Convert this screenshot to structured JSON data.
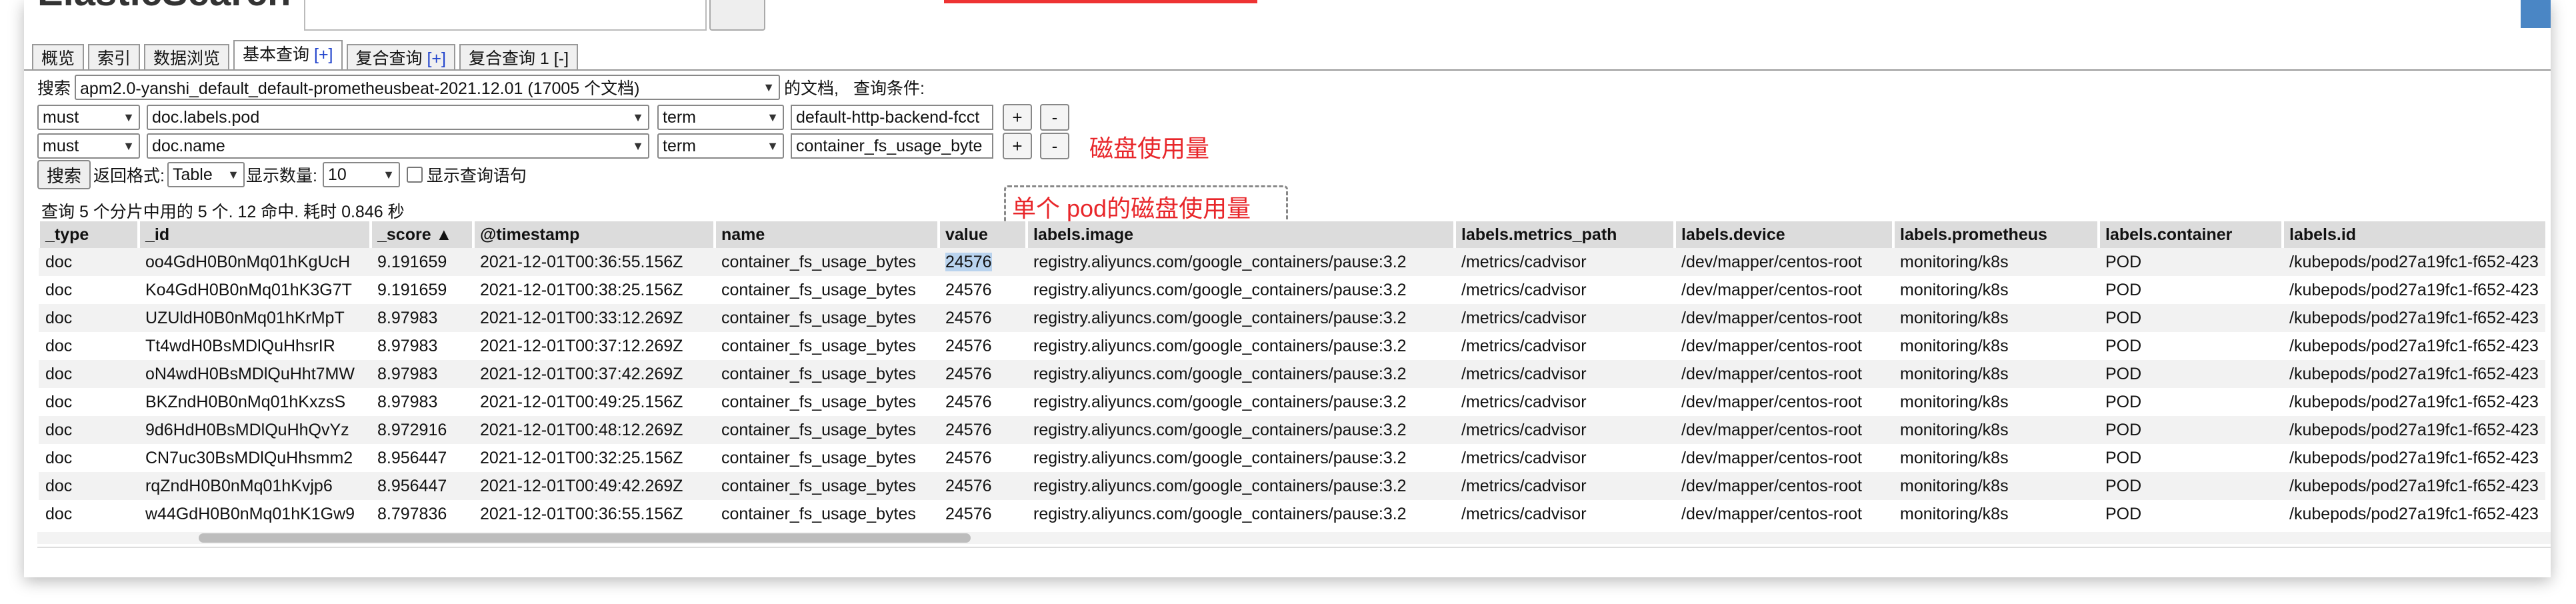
{
  "header": {
    "brand": "ElasticSearch"
  },
  "tabs": [
    {
      "label": "概览"
    },
    {
      "label": "索引"
    },
    {
      "label": "数据浏览"
    },
    {
      "label": "基本查询",
      "suffix": "[+]"
    },
    {
      "label": "复合查询",
      "suffix": "[+]"
    },
    {
      "label": "复合查询 1",
      "suffix": "[-]"
    }
  ],
  "query": {
    "search_label": "搜索",
    "index_select": "apm2.0-yanshi_default_default-prometheusbeat-2021.12.01 (17005 个文档)",
    "docs_label": "的文档,",
    "condition_label": "查询条件:",
    "conditions": [
      {
        "occur": "must",
        "field": "doc.labels.pod",
        "type": "term",
        "value": "default-http-backend-fcct"
      },
      {
        "occur": "must",
        "field": "doc.name",
        "type": "term",
        "value": "container_fs_usage_byte"
      }
    ],
    "add_button": "+",
    "remove_button": "-",
    "search_button": "搜索",
    "return_format_label": "返回格式:",
    "return_format": "Table",
    "display_count_label": "显示数量:",
    "display_count": "10",
    "show_query_label": "显示查询语句"
  },
  "annotations": {
    "disk_usage": "磁盘使用量",
    "pod_disk_usage": "单个 pod的磁盘使用量"
  },
  "summary": "查询 5 个分片中用的 5 个. 12 命中. 耗时 0.846 秒",
  "table": {
    "columns": [
      "_type",
      "_id",
      "_score ▲",
      "@timestamp",
      "name",
      "value",
      "labels.image",
      "labels.metrics_path",
      "labels.device",
      "labels.prometheus",
      "labels.container",
      "labels.id"
    ],
    "rows": [
      [
        "doc",
        "oo4GdH0B0nMq01hKgUcH",
        "9.191659",
        "2021-12-01T00:36:55.156Z",
        "container_fs_usage_bytes",
        "24576",
        "registry.aliyuncs.com/google_containers/pause:3.2",
        "/metrics/cadvisor",
        "/dev/mapper/centos-root",
        "monitoring/k8s",
        "POD",
        "/kubepods/pod27a19fc1-f652-423"
      ],
      [
        "doc",
        "Ko4GdH0B0nMq01hK3G7T",
        "9.191659",
        "2021-12-01T00:38:25.156Z",
        "container_fs_usage_bytes",
        "24576",
        "registry.aliyuncs.com/google_containers/pause:3.2",
        "/metrics/cadvisor",
        "/dev/mapper/centos-root",
        "monitoring/k8s",
        "POD",
        "/kubepods/pod27a19fc1-f652-423"
      ],
      [
        "doc",
        "UZUldH0B0nMq01hKrMpT",
        "8.97983",
        "2021-12-01T00:33:12.269Z",
        "container_fs_usage_bytes",
        "24576",
        "registry.aliyuncs.com/google_containers/pause:3.2",
        "/metrics/cadvisor",
        "/dev/mapper/centos-root",
        "monitoring/k8s",
        "POD",
        "/kubepods/pod27a19fc1-f652-423"
      ],
      [
        "doc",
        "Tt4wdH0BsMDlQuHhsrIR",
        "8.97983",
        "2021-12-01T00:37:12.269Z",
        "container_fs_usage_bytes",
        "24576",
        "registry.aliyuncs.com/google_containers/pause:3.2",
        "/metrics/cadvisor",
        "/dev/mapper/centos-root",
        "monitoring/k8s",
        "POD",
        "/kubepods/pod27a19fc1-f652-423"
      ],
      [
        "doc",
        "oN4wdH0BsMDlQuHht7MW",
        "8.97983",
        "2021-12-01T00:37:42.269Z",
        "container_fs_usage_bytes",
        "24576",
        "registry.aliyuncs.com/google_containers/pause:3.2",
        "/metrics/cadvisor",
        "/dev/mapper/centos-root",
        "monitoring/k8s",
        "POD",
        "/kubepods/pod27a19fc1-f652-423"
      ],
      [
        "doc",
        "BKZndH0B0nMq01hKxzsS",
        "8.97983",
        "2021-12-01T00:49:25.156Z",
        "container_fs_usage_bytes",
        "24576",
        "registry.aliyuncs.com/google_containers/pause:3.2",
        "/metrics/cadvisor",
        "/dev/mapper/centos-root",
        "monitoring/k8s",
        "POD",
        "/kubepods/pod27a19fc1-f652-423"
      ],
      [
        "doc",
        "9d6HdH0BsMDlQuHhQvYz",
        "8.972916",
        "2021-12-01T00:48:12.269Z",
        "container_fs_usage_bytes",
        "24576",
        "registry.aliyuncs.com/google_containers/pause:3.2",
        "/metrics/cadvisor",
        "/dev/mapper/centos-root",
        "monitoring/k8s",
        "POD",
        "/kubepods/pod27a19fc1-f652-423"
      ],
      [
        "doc",
        "CN7uc30BsMDlQuHhsmm2",
        "8.956447",
        "2021-12-01T00:32:25.156Z",
        "container_fs_usage_bytes",
        "24576",
        "registry.aliyuncs.com/google_containers/pause:3.2",
        "/metrics/cadvisor",
        "/dev/mapper/centos-root",
        "monitoring/k8s",
        "POD",
        "/kubepods/pod27a19fc1-f652-423"
      ],
      [
        "doc",
        "rqZndH0B0nMq01hKvjp6",
        "8.956447",
        "2021-12-01T00:49:42.269Z",
        "container_fs_usage_bytes",
        "24576",
        "registry.aliyuncs.com/google_containers/pause:3.2",
        "/metrics/cadvisor",
        "/dev/mapper/centos-root",
        "monitoring/k8s",
        "POD",
        "/kubepods/pod27a19fc1-f652-423"
      ],
      [
        "doc",
        "w44GdH0B0nMq01hK1Gw9",
        "8.797836",
        "2021-12-01T00:36:55.156Z",
        "container_fs_usage_bytes",
        "24576",
        "registry.aliyuncs.com/google_containers/pause:3.2",
        "/metrics/cadvisor",
        "/dev/mapper/centos-root",
        "monitoring/k8s",
        "POD",
        "/kubepods/pod27a19fc1-f652-423"
      ]
    ]
  },
  "colors": {
    "annotation": "#e8262a",
    "header_bg": "#dcdcdc",
    "selection": "#b9d3ee",
    "tab_plus": "#2244cc"
  }
}
